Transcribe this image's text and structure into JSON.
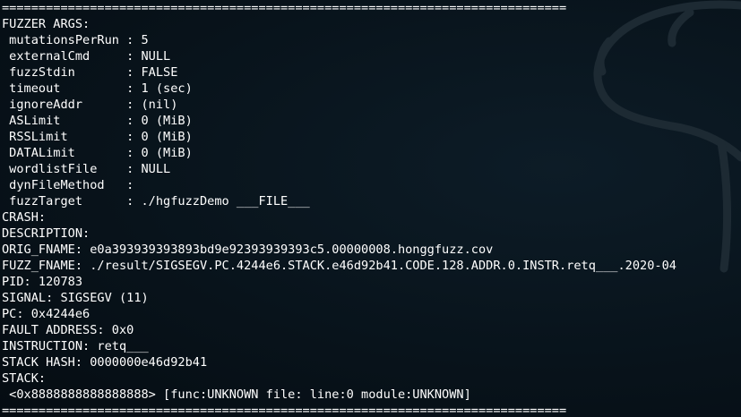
{
  "colors": {
    "background": "#071018",
    "text": "#ffffff",
    "watermark": "#1d2a33"
  },
  "watermark_icon": "kali-dragon-icon",
  "lines": [
    "=============================================================================",
    "FUZZER ARGS:",
    " mutationsPerRun : 5",
    " externalCmd     : NULL",
    " fuzzStdin       : FALSE",
    " timeout         : 1 (sec)",
    " ignoreAddr      : (nil)",
    " ASLimit         : 0 (MiB)",
    " RSSLimit        : 0 (MiB)",
    " DATALimit       : 0 (MiB)",
    " wordlistFile    : NULL",
    " dynFileMethod   : ",
    " fuzzTarget      : ./hgfuzzDemo ___FILE___",
    "CRASH:",
    "DESCRIPTION:",
    "ORIG_FNAME: e0a393939393893bd9e92393939393c5.00000008.honggfuzz.cov",
    "FUZZ_FNAME: ./result/SIGSEGV.PC.4244e6.STACK.e46d92b41.CODE.128.ADDR.0.INSTR.retq___.2020-04",
    "PID: 120783",
    "SIGNAL: SIGSEGV (11)",
    "PC: 0x4244e6",
    "FAULT ADDRESS: 0x0",
    "INSTRUCTION: retq___",
    "STACK HASH: 0000000e46d92b41",
    "STACK:",
    " <0x8888888888888888> [func:UNKNOWN file: line:0 module:UNKNOWN]",
    "============================================================================="
  ]
}
